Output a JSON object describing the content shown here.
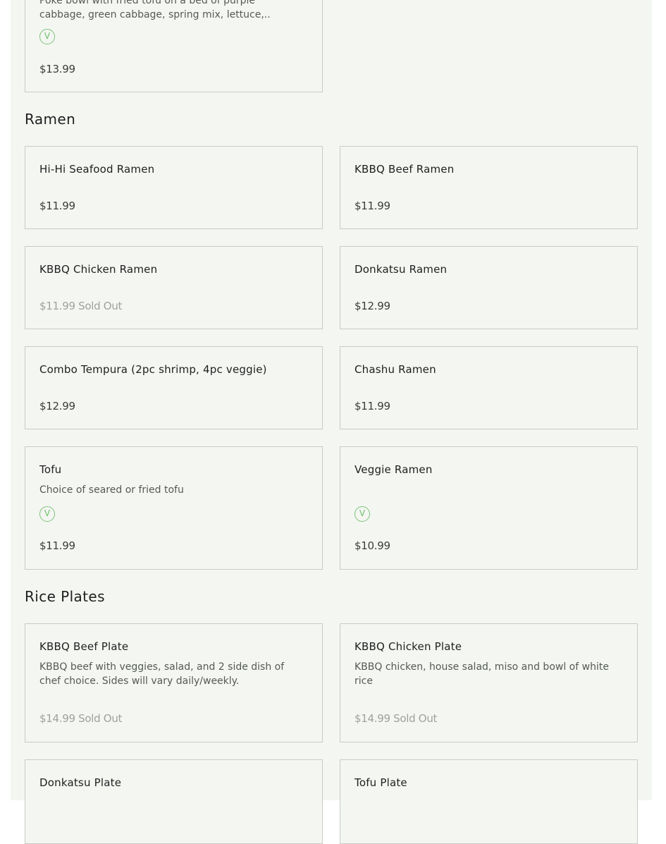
{
  "top_partial": {
    "desc_line1": "Poke bowl with fried tofu on a bed of purple",
    "desc_line2": "cabbage, green cabbage, spring mix, lettuce,..",
    "price": "$13.99",
    "vegan_icon": "V"
  },
  "sections": {
    "ramen": {
      "title": "Ramen",
      "items": [
        {
          "name": "Hi-Hi Seafood Ramen",
          "price": "$11.99"
        },
        {
          "name": "KBBQ Beef Ramen",
          "price": "$11.99"
        },
        {
          "name": "KBBQ Chicken Ramen",
          "price": "$11.99",
          "status": "Sold Out"
        },
        {
          "name": "Donkatsu Ramen",
          "price": "$12.99"
        },
        {
          "name": "Combo Tempura (2pc shrimp, 4pc veggie)",
          "price": "$12.99"
        },
        {
          "name": "Chashu Ramen",
          "price": "$11.99"
        },
        {
          "name": "Tofu",
          "description": "Choice of seared or fried tofu",
          "price": "$11.99",
          "vegan_icon": "V"
        },
        {
          "name": "Veggie Ramen",
          "price": "$10.99",
          "vegan_icon": "V"
        }
      ]
    },
    "rice_plates": {
      "title": "Rice Plates",
      "items": [
        {
          "name": "KBBQ Beef Plate",
          "description": "KBBQ beef with veggies, salad, and 2 side dish of chef choice. Sides will vary daily/weekly.",
          "price": "$14.99",
          "status": "Sold Out"
        },
        {
          "name": "KBBQ Chicken Plate",
          "description": "KBBQ chicken, house salad, miso and bowl of white rice",
          "price": "$14.99",
          "status": "Sold Out"
        },
        {
          "name": "Donkatsu Plate"
        },
        {
          "name": "Tofu Plate"
        }
      ]
    }
  },
  "colors": {
    "panel_bg": "#f4f6f2",
    "card_border": "#c9ccc5",
    "vegan_green": "#7cc47a",
    "sold_out_text": "#9ea29d"
  },
  "icons": {
    "vegan": "vegan-v-icon"
  }
}
